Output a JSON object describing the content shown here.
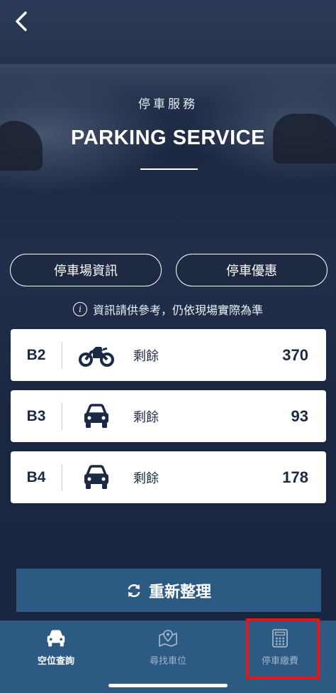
{
  "header": {
    "subtitle_zh": "停車服務",
    "title_en": "PARKING SERVICE"
  },
  "actions": {
    "lot_info_label": "停車場資訊",
    "discount_label": "停車優惠"
  },
  "notice": {
    "text": "資訊請供參考，仍依現場實際為準"
  },
  "levels": [
    {
      "level": "B2",
      "vehicle_icon": "motorcycle-icon",
      "remain_label": "剩餘",
      "count": "370"
    },
    {
      "level": "B3",
      "vehicle_icon": "car-icon",
      "remain_label": "剩餘",
      "count": "93"
    },
    {
      "level": "B4",
      "vehicle_icon": "car-icon",
      "remain_label": "剩餘",
      "count": "178"
    }
  ],
  "refresh": {
    "label": "重新整理",
    "icon": "refresh-icon"
  },
  "tabbar": {
    "tabs": [
      {
        "label": "空位查詢",
        "icon": "car-front-icon",
        "active": true
      },
      {
        "label": "尋找車位",
        "icon": "map-pin-icon",
        "active": false
      },
      {
        "label": "停車繳費",
        "icon": "calculator-icon",
        "active": false
      }
    ]
  },
  "colors": {
    "background": "#1e2b45",
    "accent": "#2c5a82",
    "card_text": "#1b2a44",
    "highlight": "#e8141a"
  }
}
